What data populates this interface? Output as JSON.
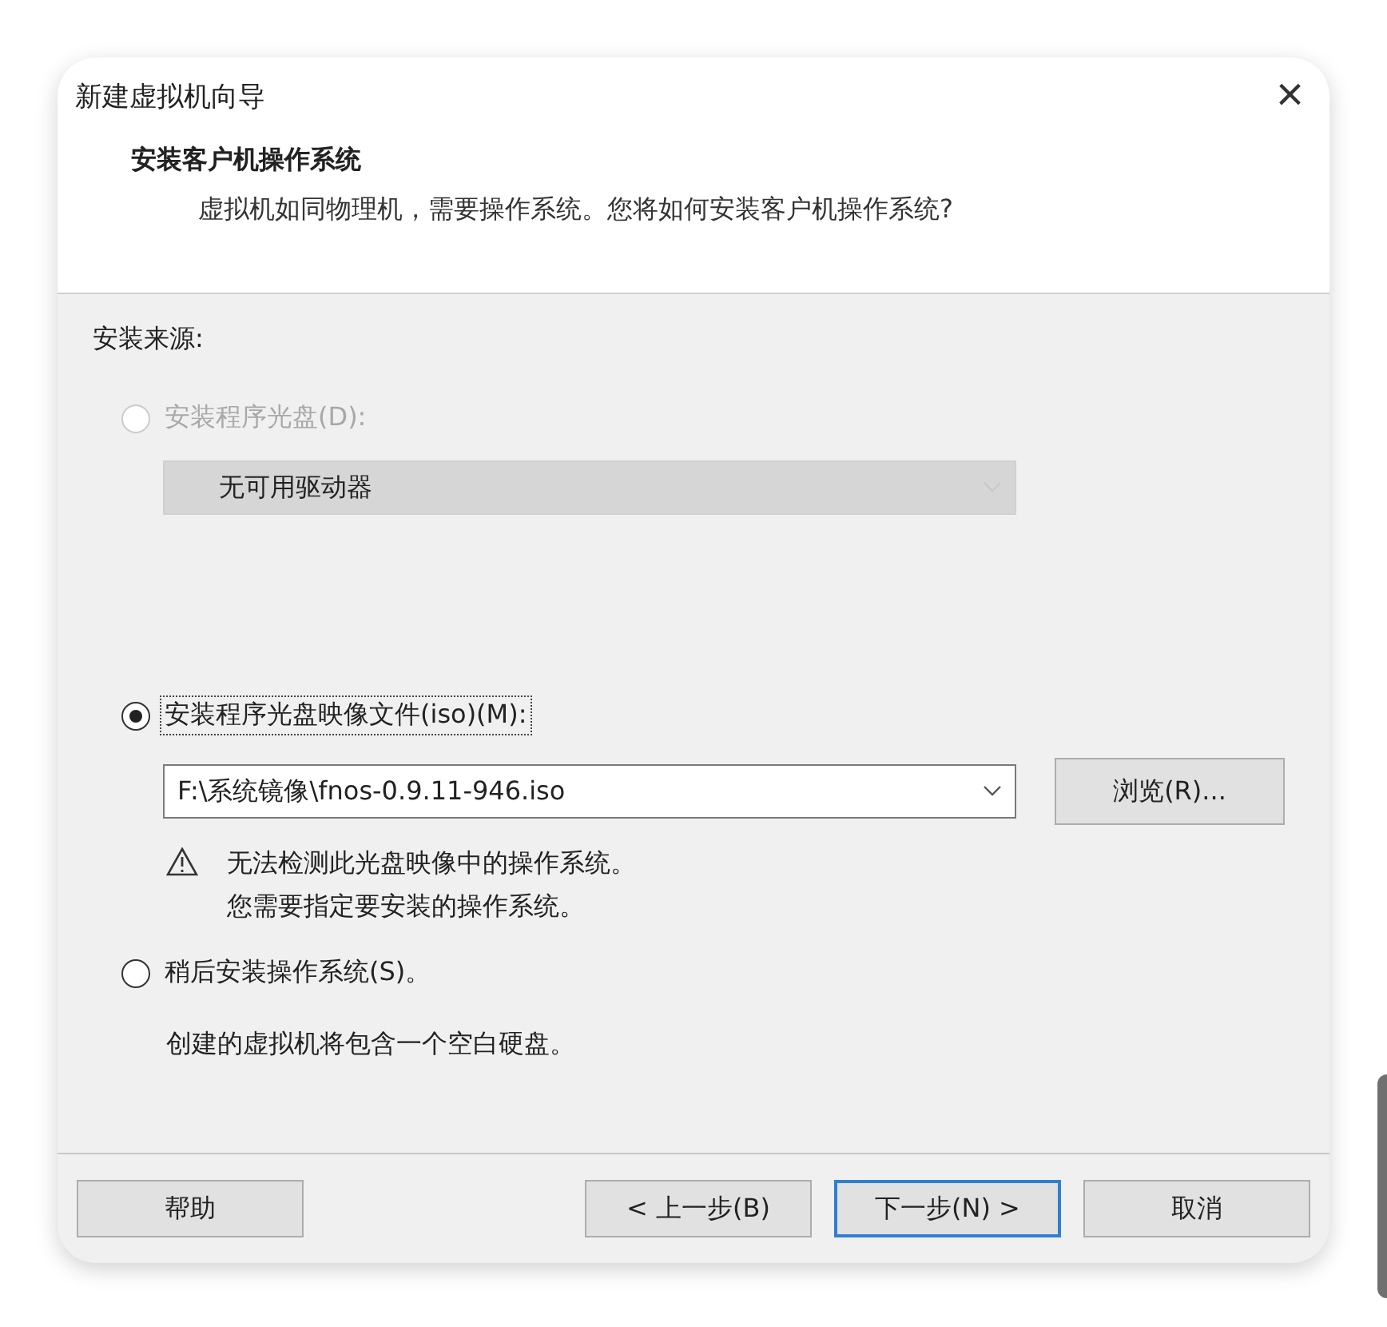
{
  "window": {
    "title": "新建虚拟机向导",
    "close": "×"
  },
  "header": {
    "title": "安装客户机操作系统",
    "subtitle": "虚拟机如同物理机，需要操作系统。您将如何安装客户机操作系统?"
  },
  "source_label": "安装来源:",
  "options": [
    {
      "kind": "disc",
      "label": "安装程序光盘(D):",
      "selected": false,
      "disabled": true,
      "dropdown": {
        "value": "无可用驱动器",
        "disabled": true
      }
    },
    {
      "kind": "iso",
      "label": "安装程序光盘映像文件(iso)(M):",
      "selected": true,
      "disabled": false,
      "focused": true,
      "dropdown": {
        "value": "F:\\系统镜像\\fnos-0.9.11-946.iso",
        "disabled": false
      },
      "browse": "浏览(R)...",
      "warning": [
        "无法检测此光盘映像中的操作系统。",
        "您需要指定要安装的操作系统。"
      ]
    },
    {
      "kind": "later",
      "label": "稍后安装操作系统(S)。",
      "selected": false,
      "disabled": false,
      "note": "创建的虚拟机将包含一个空白硬盘。"
    }
  ],
  "buttons": [
    {
      "label": "帮助",
      "default": false
    },
    {
      "label": "< 上一步(B)",
      "default": false
    },
    {
      "label": "下一步(N) >",
      "default": true
    },
    {
      "label": "取消",
      "default": false
    }
  ]
}
